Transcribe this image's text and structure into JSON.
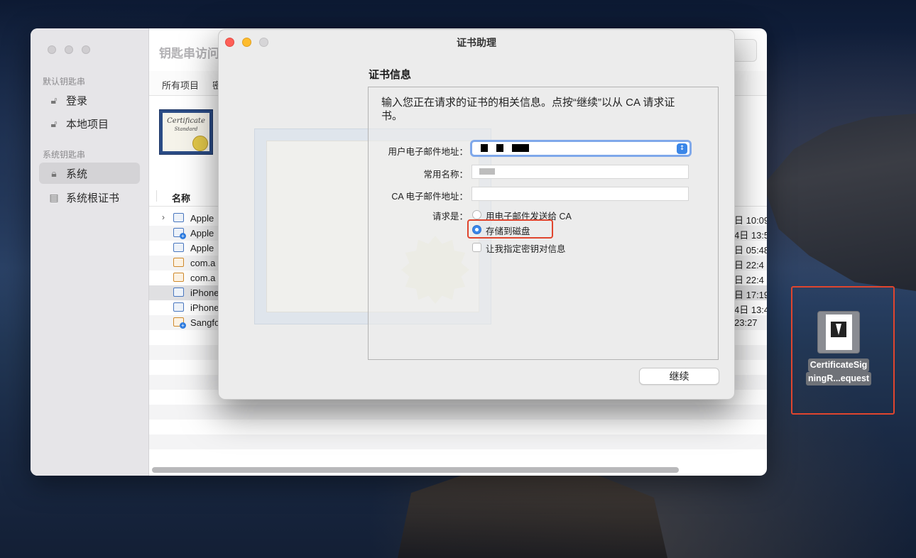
{
  "keychain": {
    "title": "钥匙串访问",
    "sidebar": {
      "default_heading": "默认钥匙串",
      "system_heading": "系统钥匙串",
      "items": [
        {
          "label": "登录",
          "icon": "unlock-icon"
        },
        {
          "label": "本地项目",
          "icon": "unlock-icon"
        },
        {
          "label": "系统",
          "icon": "lock-icon",
          "selected": true
        },
        {
          "label": "系统根证书",
          "icon": "cabinet-icon"
        }
      ]
    },
    "tabs": [
      "所有项目",
      "密"
    ],
    "cert_preview": {
      "line1": "Certificate",
      "line2": "Standard"
    },
    "column_header": "名称",
    "rows": [
      {
        "name": "Apple",
        "date": "日 10:09",
        "expandable": true
      },
      {
        "name": "Apple",
        "date": "4日 13:5"
      },
      {
        "name": "Apple",
        "date": "日 05:48"
      },
      {
        "name": "com.a",
        "date": "日 22:4"
      },
      {
        "name": "com.a",
        "date": "日 22:4"
      },
      {
        "name": "iPhone",
        "date": "日 17:19",
        "selected": true
      },
      {
        "name": "iPhone",
        "date": "4日 13:4"
      },
      {
        "name": "Sangfo",
        "date": "23:27"
      }
    ]
  },
  "assistant": {
    "title": "证书助理",
    "section_title": "证书信息",
    "intro": "输入您正在请求的证书的相关信息。点按“继续”以从 CA 请求证书。",
    "labels": {
      "email": "用户电子邮件地址：",
      "common_name": "常用名称：",
      "ca_email": "CA 电子邮件地址：",
      "request": "请求是："
    },
    "options": {
      "email_ca": "用电子邮件发送给 CA",
      "save_disk": "存储到磁盘",
      "key_pair": "让我指定密钥对信息"
    },
    "selected_option": "存储到磁盘",
    "continue_label": "继续"
  },
  "desktop_file": {
    "name_line1": "CertificateSig",
    "name_line2": "ningR...equest"
  },
  "colors": {
    "accent": "#3a86e8",
    "highlight": "#e0452e"
  }
}
